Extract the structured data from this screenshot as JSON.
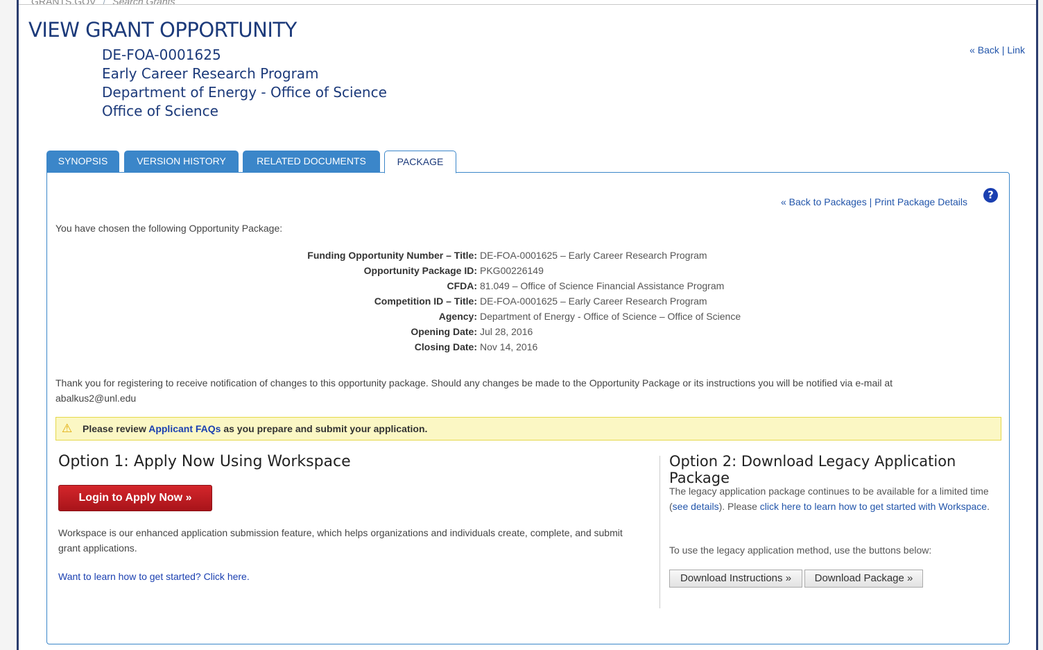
{
  "breadcrumb": {
    "home": "GRANTS.GOV",
    "current": "Search Grants"
  },
  "page_title": "VIEW GRANT OPPORTUNITY",
  "header": {
    "number": "DE-FOA-0001625",
    "program": "Early Career Research Program",
    "agency": "Department of Energy - Office of Science",
    "office": "Office of Science"
  },
  "top_links": {
    "back": "« Back",
    "sep": "|",
    "link": "Link"
  },
  "tabs": [
    {
      "label": "SYNOPSIS"
    },
    {
      "label": "VERSION HISTORY"
    },
    {
      "label": "RELATED DOCUMENTS"
    },
    {
      "label": "PACKAGE"
    }
  ],
  "panel_links": {
    "back_packages": "« Back to Packages",
    "sep": "|",
    "print": "Print Package Details"
  },
  "help": "?",
  "intro": "You have chosen the following Opportunity Package:",
  "details": [
    {
      "label": "Funding Opportunity Number – Title:",
      "value": "DE-FOA-0001625 – Early Career Research Program"
    },
    {
      "label": "Opportunity Package ID:",
      "value": "PKG00226149"
    },
    {
      "label": "CFDA:",
      "value": "81.049 – Office of Science Financial Assistance Program"
    },
    {
      "label": "Competition ID – Title:",
      "value": "DE-FOA-0001625 – Early Career Research Program"
    },
    {
      "label": "Agency:",
      "value": "Department of Energy - Office of Science – Office of Science"
    },
    {
      "label": "Opening Date:",
      "value": "Jul 28, 2016"
    },
    {
      "label": "Closing Date:",
      "value": "Nov 14, 2016"
    }
  ],
  "notice": "Thank you for registering to receive notification of changes to this opportunity package. Should any changes be made to the Opportunity Package or its instructions you will be notified via e-mail at abalkus2@unl.edu",
  "alert": {
    "icon": "warning-icon",
    "pre": "Please review ",
    "link": "Applicant FAQs",
    "post": " as you prepare and submit your application."
  },
  "option1": {
    "title": "Option 1: Apply Now Using Workspace",
    "button": "Login to Apply Now »",
    "desc": "Workspace is our enhanced application submission feature, which helps organizations and individuals create, complete, and submit grant applications.",
    "learn": "Want to learn how to get started? Click here."
  },
  "option2": {
    "title": "Option 2: Download Legacy Application Package",
    "legacy_pre": "The legacy application package continues to be available for a limited time (",
    "legacy_link1": "see details",
    "legacy_mid": "). Please ",
    "legacy_link2": "click here to learn how to get started with Workspace",
    "legacy_post": ".",
    "use": "To use the legacy application method, use the buttons below:",
    "btn_instructions": "Download Instructions »",
    "btn_package": "Download Package »"
  },
  "colors": {
    "brand": "#1c3a7a",
    "tab": "#3b86c9",
    "login": "#c41e24",
    "alert_bg": "#fbf7c4"
  }
}
